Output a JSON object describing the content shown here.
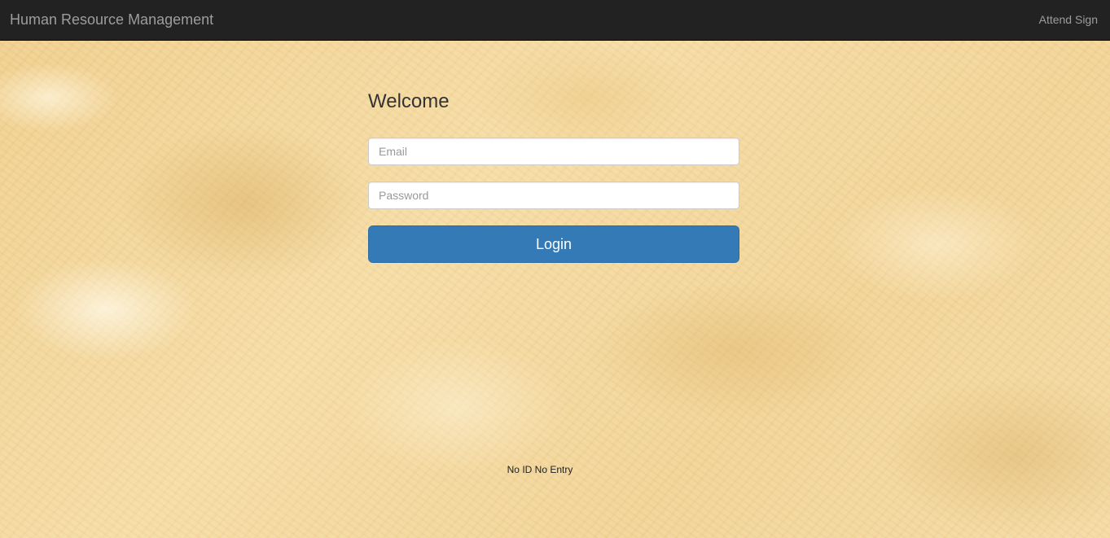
{
  "navbar": {
    "brand": "Human Resource Management",
    "right_link": "Attend Sign"
  },
  "login": {
    "title": "Welcome",
    "email_placeholder": "Email",
    "password_placeholder": "Password",
    "submit_label": "Login"
  },
  "footer": {
    "note": "No ID No Entry"
  },
  "colors": {
    "navbar_bg": "#222222",
    "navbar_text": "#9d9d9d",
    "primary_button": "#337ab7",
    "background": "#f3d9a0"
  }
}
